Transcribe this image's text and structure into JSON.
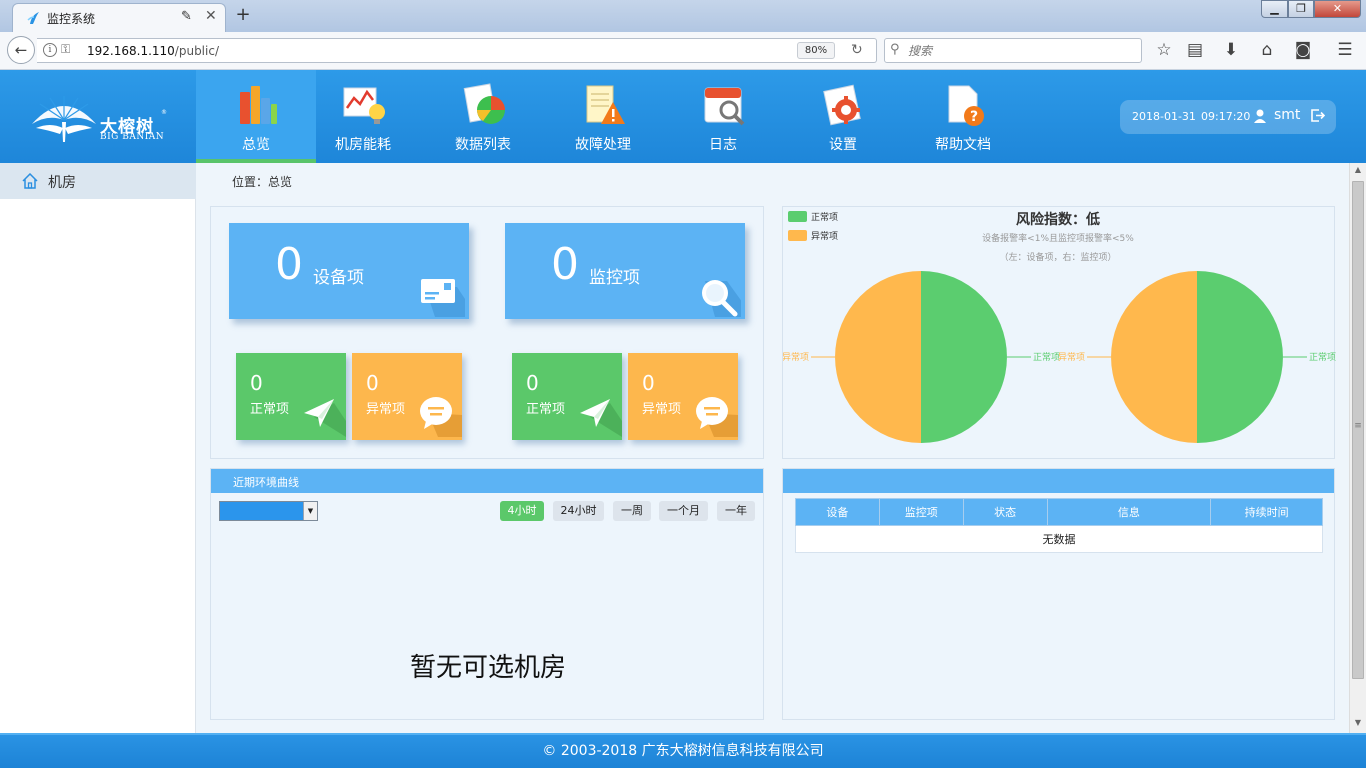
{
  "browser": {
    "tab_title": "监控系统",
    "new_tab": "+",
    "url_host": "192.168.1.110",
    "url_path": "/public/",
    "zoom": "80%",
    "search_placeholder": "搜索"
  },
  "header": {
    "logo_cn": "大榕树",
    "logo_en": "BIG BANIAN",
    "logo_reg": "®",
    "nav": [
      {
        "label": "总览",
        "active": true
      },
      {
        "label": "机房能耗"
      },
      {
        "label": "数据列表"
      },
      {
        "label": "故障处理"
      },
      {
        "label": "日志"
      },
      {
        "label": "设置"
      },
      {
        "label": "帮助文档"
      }
    ],
    "date": "2018-01-31",
    "time": "09:17:20",
    "user": "smt"
  },
  "sidebar": {
    "items": [
      {
        "label": "机房"
      }
    ]
  },
  "breadcrumb": "位置：总览",
  "stats": {
    "device": {
      "count": "0",
      "label": "设备项",
      "normal_count": "0",
      "normal_label": "正常项",
      "abnormal_count": "0",
      "abnormal_label": "异常项"
    },
    "monitor": {
      "count": "0",
      "label": "监控项",
      "normal_count": "0",
      "normal_label": "正常项",
      "abnormal_count": "0",
      "abnormal_label": "异常项"
    }
  },
  "chart_data": {
    "type": "pie",
    "title": "风险指数：低",
    "subtitle": "设备报警率<1%且监控项报警率<5%",
    "note": "（左：设备项，右：监控项）",
    "legend_placement": "top-left",
    "legend": [
      {
        "name": "正常项",
        "color": "#5bcd6f"
      },
      {
        "name": "异常项",
        "color": "#ffb84d"
      }
    ],
    "pies": [
      {
        "slices": [
          {
            "name": "正常项",
            "value": 50,
            "color": "#5bcd6f"
          },
          {
            "name": "异常项",
            "value": 50,
            "color": "#ffb84d"
          }
        ]
      },
      {
        "slices": [
          {
            "name": "正常项",
            "value": 50,
            "color": "#5bcd6f"
          },
          {
            "name": "异常项",
            "value": 50,
            "color": "#ffb84d"
          }
        ]
      }
    ]
  },
  "env": {
    "title": "近期环境曲线",
    "ranges": [
      {
        "label": "4小时",
        "active": true
      },
      {
        "label": "24小时"
      },
      {
        "label": "一周"
      },
      {
        "label": "一个月"
      },
      {
        "label": "一年"
      }
    ],
    "empty_text": "暂无可选机房"
  },
  "alarms": {
    "columns": [
      "设备",
      "监控项",
      "状态",
      "信息",
      "持续时间"
    ],
    "empty_text": "无数据"
  },
  "footer": "© 2003-2018  广东大榕树信息科技有限公司",
  "colors": {
    "brand_blue": "#1e86d9",
    "card_blue": "#5cb3f4",
    "normal_green": "#5bc86a",
    "abnormal_orange": "#fdb74d"
  }
}
